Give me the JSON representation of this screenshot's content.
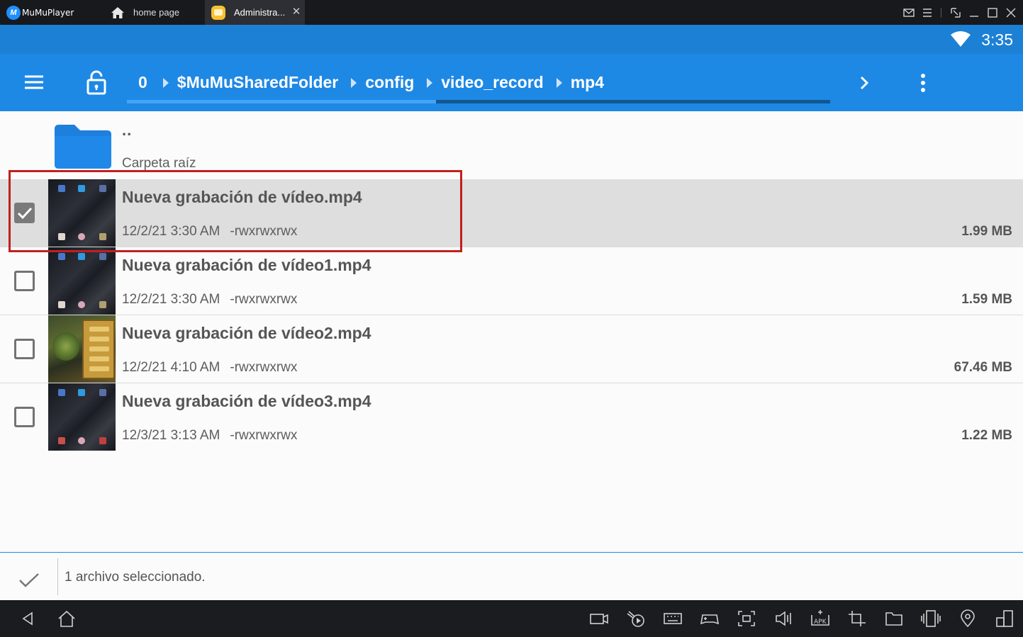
{
  "titlebar": {
    "app_name": "MuMuPlayer",
    "tabs": [
      {
        "label": "home page",
        "icon": "home-icon"
      },
      {
        "label": "Administra...",
        "icon": "file-manager-app-icon"
      }
    ],
    "controls": [
      "mail-icon",
      "menu-icon",
      "shrink-icon",
      "minimize-icon",
      "maximize-icon",
      "close-icon"
    ]
  },
  "statusbar": {
    "time": "3:35"
  },
  "appbar": {
    "breadcrumbs": [
      "0",
      "$MuMuSharedFolder",
      "config",
      "video_record",
      "mp4"
    ],
    "progress": 0.44
  },
  "list": {
    "parent": {
      "name": "..",
      "subtitle": "Carpeta raíz"
    },
    "files": [
      {
        "name": "Nueva grabación de vídeo.mp4",
        "date": "12/2/21 3:30 AM",
        "perms": "-rwxrwxrwx",
        "size": "1.99 MB",
        "selected": true
      },
      {
        "name": "Nueva grabación de vídeo1.mp4",
        "date": "12/2/21 3:30 AM",
        "perms": "-rwxrwxrwx",
        "size": "1.59 MB",
        "selected": false
      },
      {
        "name": "Nueva grabación de vídeo2.mp4",
        "date": "12/2/21 4:10 AM",
        "perms": "-rwxrwxrwx",
        "size": "67.46 MB",
        "selected": false
      },
      {
        "name": "Nueva grabación de vídeo3.mp4",
        "date": "12/3/21 3:13 AM",
        "perms": "-rwxrwxrwx",
        "size": "1.22 MB",
        "selected": false
      }
    ]
  },
  "selection": {
    "text": "1 archivo seleccionado."
  },
  "colors": {
    "accent": "#1e88e5",
    "statusbar": "#1c80d4",
    "highlight": "#c0201f"
  }
}
